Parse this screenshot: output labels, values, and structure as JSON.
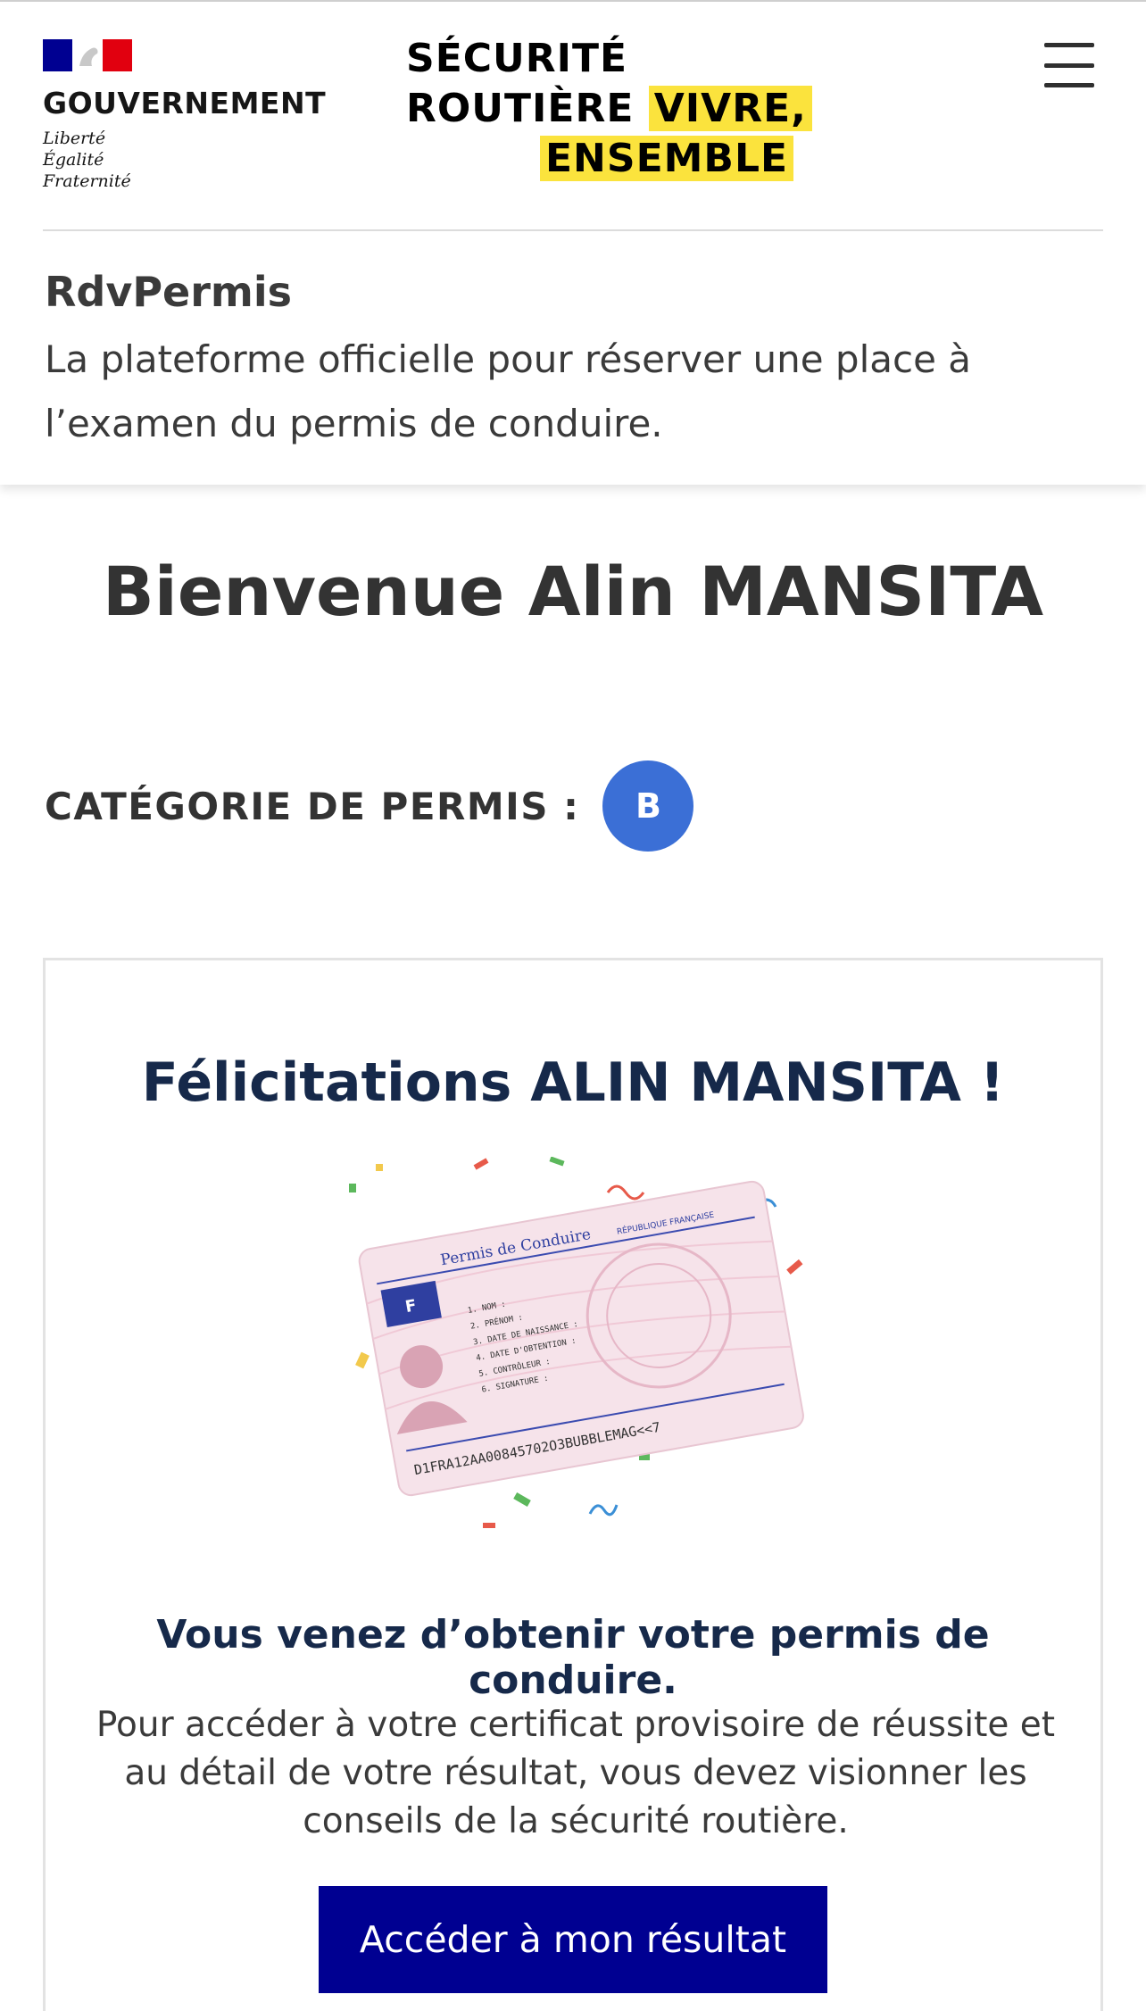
{
  "header": {
    "gov_title": "GOUVERNEMENT",
    "devise": [
      "Liberté",
      "Égalité",
      "Fraternité"
    ],
    "brand_lines": [
      "SÉCURITÉ",
      "ROUTIÈRE",
      "VIVRE,",
      "ENSEMBLE"
    ],
    "menu_icon": "hamburger-menu-icon",
    "app_name": "RdvPermis",
    "app_description": "La plateforme officielle pour réserver une place à l’examen du permis de conduire."
  },
  "main": {
    "welcome": "Bienvenue Alin MANSITA",
    "category_label": "CATÉGORIE DE PERMIS :",
    "category_value": "B",
    "card": {
      "congrats_prefix": "Félicitations ",
      "congrats_name": "ALIN MANSITA !",
      "license_title": "Permis de Conduire",
      "license_country": "RÉPUBLIQUE FRANÇAISE",
      "license_flag_letter": "F",
      "license_fields": [
        "1. NOM :",
        "2. PRÉNOM :",
        "3. DATE DE NAISSANCE :",
        "4. DATE D'OBTENTION :",
        "5. CONTRÔLEUR :",
        "6. SIGNATURE :"
      ],
      "license_mrz": "D1FRA12AA00845702O3BUBBLEMAG<<7",
      "license_stamp": "RÉPUBLIQUE FRANÇAISE PERMIS DE CONDUIRE",
      "obtained": "Vous venez d’obtenir votre permis de conduire.",
      "info": "Pour accéder à votre certificat provisoire de réussite et au détail de votre résultat, vous devez visionner les conseils de la sécurité routière.",
      "cta_label": "Accéder à mon résultat"
    }
  },
  "colors": {
    "primary_blue": "#000091",
    "badge_blue": "#3b6fd6",
    "brand_yellow": "#fbe33d",
    "heading_navy": "#16294a",
    "flag_red": "#e1000f"
  }
}
